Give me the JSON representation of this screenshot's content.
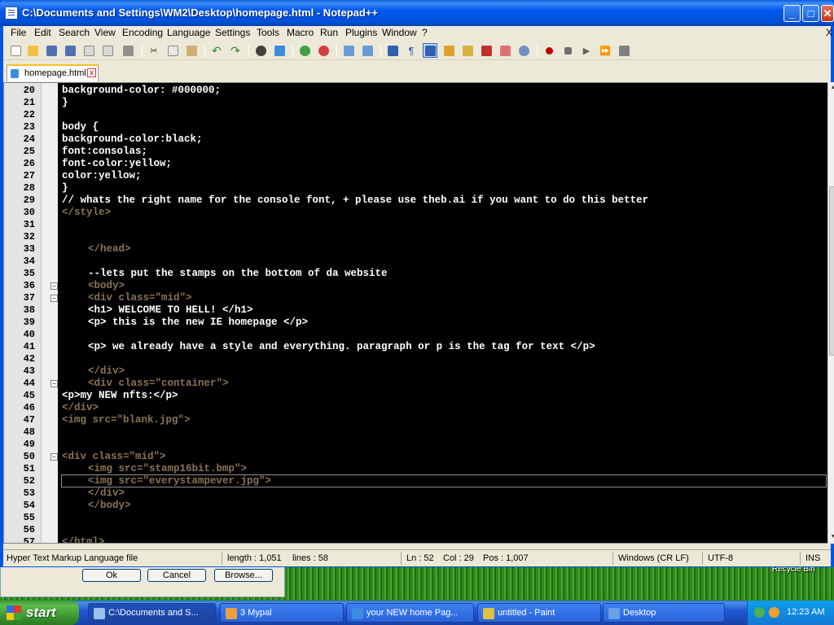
{
  "window": {
    "title": "C:\\Documents and Settings\\WM2\\Desktop\\homepage.html - Notepad++",
    "minimize": "_",
    "maximize": "□",
    "close": "✕"
  },
  "menu": [
    "File",
    "Edit",
    "Search",
    "View",
    "Encoding",
    "Language",
    "Settings",
    "Tools",
    "Macro",
    "Run",
    "Plugins",
    "Window",
    "?"
  ],
  "menu_extra": "X",
  "tab": {
    "label": "homepage.html",
    "close": "x"
  },
  "code": [
    {
      "n": "20",
      "text": "background-color: #000000;",
      "color": "#ffffff",
      "indent": 0
    },
    {
      "n": "21",
      "text": "}",
      "color": "#ffffff",
      "indent": 0
    },
    {
      "n": "22",
      "text": "",
      "color": "#ffffff",
      "indent": 0
    },
    {
      "n": "23",
      "text": "body {",
      "color": "#ffffff",
      "indent": 0
    },
    {
      "n": "24",
      "text": "background-color:black;",
      "color": "#ffffff",
      "indent": 0
    },
    {
      "n": "25",
      "text": "font:consolas;",
      "color": "#ffffff",
      "indent": 0
    },
    {
      "n": "26",
      "text": "font-color:yellow;",
      "color": "#ffffff",
      "indent": 0
    },
    {
      "n": "27",
      "text": "color:yellow;",
      "color": "#ffffff",
      "indent": 0
    },
    {
      "n": "28",
      "text": "}",
      "color": "#ffffff",
      "indent": 0
    },
    {
      "n": "29",
      "text": "// whats the right name for the console font, + please use theb.ai if you want to do this better",
      "color": "#ffffff",
      "indent": 0
    },
    {
      "n": "30",
      "text": "</style>",
      "color": "#8a7355",
      "indent": 0
    },
    {
      "n": "31",
      "text": "",
      "color": "#ffffff",
      "indent": 0
    },
    {
      "n": "32",
      "text": "",
      "color": "#ffffff",
      "indent": 0
    },
    {
      "n": "33",
      "text": "</head>",
      "color": "#8a7355",
      "indent": 4
    },
    {
      "n": "34",
      "text": "",
      "color": "#ffffff",
      "indent": 0
    },
    {
      "n": "35",
      "text": "--lets put the stamps on the bottom of da website",
      "color": "#ffffff",
      "indent": 4
    },
    {
      "n": "36",
      "text": "<body>",
      "color": "#8a7355",
      "indent": 4,
      "fold": true
    },
    {
      "n": "37",
      "text": "<div class=\"mid\">",
      "color": "#8a7355",
      "indent": 4,
      "fold": true
    },
    {
      "n": "38",
      "text": "<h1> WELCOME TO HELL! </h1>",
      "color": "#ffffff",
      "indent": 4
    },
    {
      "n": "39",
      "text": "<p> this is the new IE homepage </p>",
      "color": "#ffffff",
      "indent": 4
    },
    {
      "n": "40",
      "text": "",
      "color": "#ffffff",
      "indent": 0
    },
    {
      "n": "41",
      "text": "<p> we already have a style and everything. paragraph or p is the tag for text </p>",
      "color": "#ffffff",
      "indent": 4
    },
    {
      "n": "42",
      "text": "",
      "color": "#ffffff",
      "indent": 0
    },
    {
      "n": "43",
      "text": "</div>",
      "color": "#8a7355",
      "indent": 4
    },
    {
      "n": "44",
      "text": "<div class=\"container\">",
      "color": "#8a7355",
      "indent": 4,
      "fold": true
    },
    {
      "n": "45",
      "text": "<p>my NEW nfts:</p>",
      "color": "#ffffff",
      "indent": 0
    },
    {
      "n": "46",
      "text": "</div>",
      "color": "#8a7355",
      "indent": 0
    },
    {
      "n": "47",
      "text": "<img src=\"blank.jpg\">",
      "color": "#8a7355",
      "indent": 0
    },
    {
      "n": "48",
      "text": "",
      "color": "#ffffff",
      "indent": 0
    },
    {
      "n": "49",
      "text": "",
      "color": "#ffffff",
      "indent": 0
    },
    {
      "n": "50",
      "text": "<div class=\"mid\">",
      "color": "#8a7355",
      "indent": 0,
      "fold": true
    },
    {
      "n": "51",
      "text": "<img src=\"stamp16bit.bmp\">",
      "color": "#8a7355",
      "indent": 4
    },
    {
      "n": "52",
      "text": "<img src=\"everystampever.jpg\">",
      "color": "#8a7355",
      "indent": 4
    },
    {
      "n": "53",
      "text": "</div>",
      "color": "#8a7355",
      "indent": 4
    },
    {
      "n": "54",
      "text": "</body>",
      "color": "#8a7355",
      "indent": 4
    },
    {
      "n": "55",
      "text": "",
      "color": "#ffffff",
      "indent": 0
    },
    {
      "n": "56",
      "text": "",
      "color": "#ffffff",
      "indent": 0
    },
    {
      "n": "57",
      "text": "</html>",
      "color": "#8a7355",
      "indent": 0
    }
  ],
  "status": {
    "filetype": "Hyper Text Markup Language file",
    "length": "length : 1,051",
    "lines": "lines : 58",
    "ln": "Ln : 52",
    "col": "Col : 29",
    "pos": "Pos : 1,007",
    "eol": "Windows (CR LF)",
    "encoding": "UTF-8",
    "mode": "INS"
  },
  "dialog": {
    "ok": "Ok",
    "cancel": "Cancel",
    "browse": "Browse..."
  },
  "desktop": {
    "recycle_bin": "Recycle Bin"
  },
  "taskbar": {
    "start": "start",
    "tasks": [
      {
        "label": "C:\\Documents and S...",
        "icon_color": "#9bc1f2"
      },
      {
        "label": "3 Mypal",
        "icon_color": "#e8a040"
      },
      {
        "label": "your NEW home Pag...",
        "icon_color": "#3c8be0"
      },
      {
        "label": "untitled - Paint",
        "icon_color": "#e0c040"
      },
      {
        "label": "Desktop",
        "icon_color": "#6aa0e8"
      }
    ],
    "clock": "12:23 AM"
  },
  "colors": {
    "tag": "#8a7355",
    "text": "#ffffff",
    "editor_bg": "#000000",
    "title_bar": "#0058ee"
  }
}
